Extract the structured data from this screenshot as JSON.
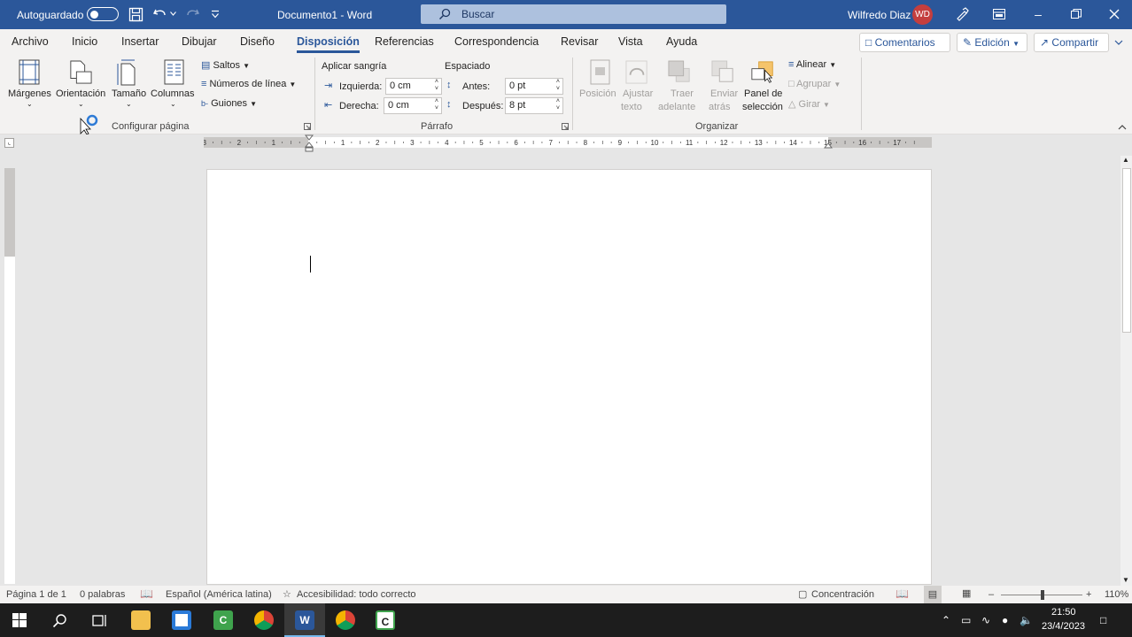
{
  "titlebar": {
    "autosave_label": "Autoguardado",
    "doc_title": "Documento1  -  Word",
    "search_placeholder": "Buscar",
    "user_name": "Wilfredo Diaz",
    "user_initials": "WD"
  },
  "tabs": [
    "Archivo",
    "Inicio",
    "Insertar",
    "Dibujar",
    "Diseño",
    "Disposición",
    "Referencias",
    "Correspondencia",
    "Revisar",
    "Vista",
    "Ayuda"
  ],
  "active_tab": "Disposición",
  "right_buttons": {
    "comments": "Comentarios",
    "editing": "Edición",
    "share": "Compartir"
  },
  "ribbon": {
    "page_setup": {
      "margins": "Márgenes",
      "orientation": "Orientación",
      "size": "Tamaño",
      "columns": "Columnas",
      "breaks": "Saltos",
      "line_numbers": "Números de línea",
      "hyphenation": "Guiones",
      "group_label": "Configurar página"
    },
    "paragraph": {
      "indent_title": "Aplicar sangría",
      "left_label": "Izquierda:",
      "left_value": "0 cm",
      "right_label": "Derecha:",
      "right_value": "0 cm",
      "spacing_title": "Espaciado",
      "before_label": "Antes:",
      "before_value": "0 pt",
      "after_label": "Después:",
      "after_value": "8 pt",
      "group_label": "Párrafo"
    },
    "arrange": {
      "position_1": "Posición",
      "wrap_1": "Ajustar",
      "wrap_2": "texto",
      "forward_1": "Traer",
      "forward_2": "adelante",
      "backward_1": "Enviar",
      "backward_2": "atrás",
      "pane_1": "Panel de",
      "pane_2": "selección",
      "align": "Alinear",
      "group": "Agrupar",
      "rotate": "Girar",
      "group_label": "Organizar"
    }
  },
  "ruler_numbers": [
    "3",
    "2",
    "1",
    "1",
    "2",
    "3",
    "4",
    "5",
    "6",
    "7",
    "8",
    "9",
    "10",
    "11",
    "12",
    "13",
    "14",
    "15",
    "16",
    "17"
  ],
  "statusbar": {
    "page": "Página 1 de 1",
    "words": "0 palabras",
    "language": "Español (América latina)",
    "accessibility": "Accesibilidad: todo correcto",
    "focus": "Concentración",
    "zoom": "110%"
  },
  "taskbar": {
    "time": "21:50",
    "date": "23/4/2023"
  },
  "colors": {
    "word_blue": "#2b579a",
    "ribbon_bg": "#f3f2f1",
    "avatar": "#c43e3e",
    "taskbar": "#1d1d1d"
  }
}
